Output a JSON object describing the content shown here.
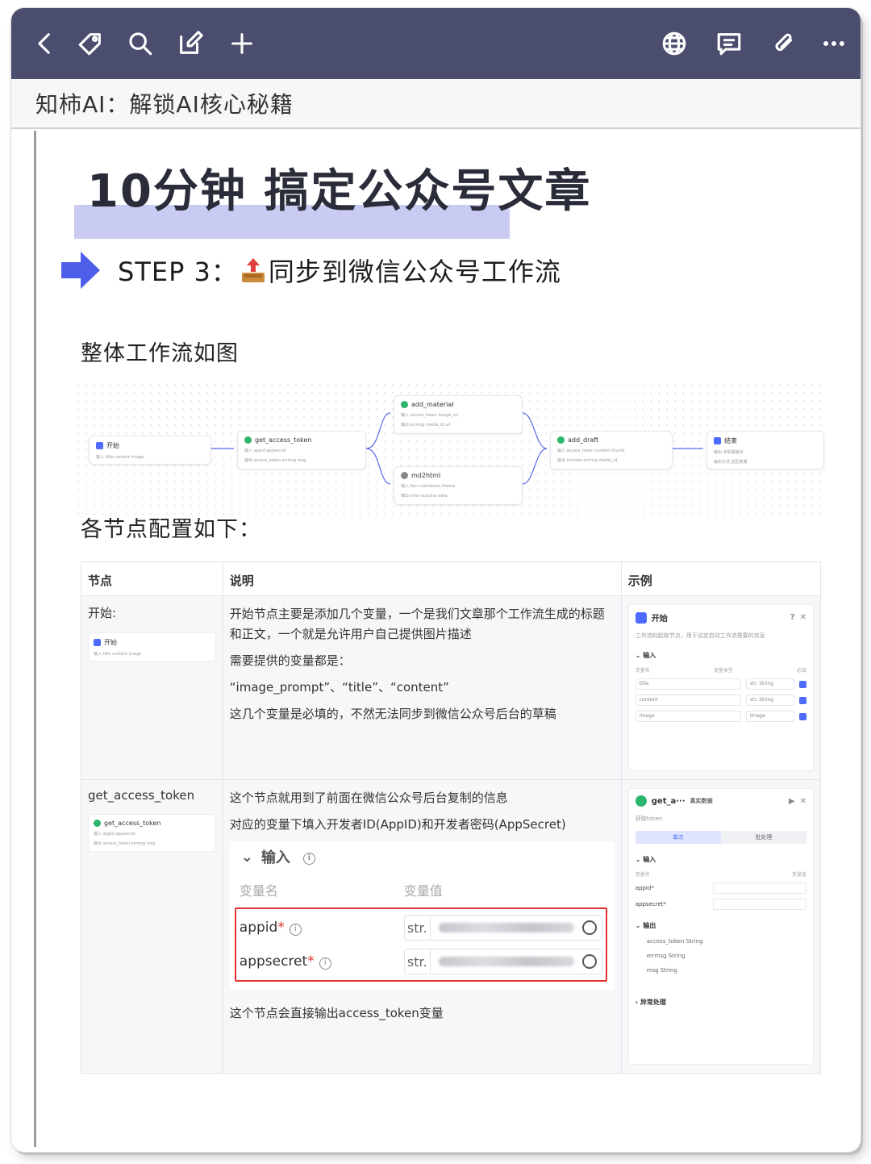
{
  "toolbar": {
    "icons": [
      "back-icon",
      "tag-icon",
      "search-icon",
      "edit-icon",
      "plus-icon",
      "globe-icon",
      "comment-icon",
      "attachment-icon",
      "more-icon"
    ]
  },
  "note": {
    "title": "知柿AI：解锁AI核心秘籍"
  },
  "doc": {
    "title": "10分钟 搞定公众号文章",
    "step_prefix": "STEP 3：",
    "step_text": "同步到微信公众号工作流",
    "flow_heading": "整体工作流如图",
    "nodes_heading": "各节点配置如下："
  },
  "flow": {
    "start": {
      "name": "开始",
      "row": "输入 title  content  image"
    },
    "get_token": {
      "name": "get_access_token",
      "row1": "输入 appid  appsecret",
      "row2": "输出 access_token  errmsg  msg"
    },
    "add_material": {
      "name": "add_material",
      "row1": "输入 access_token  image_url",
      "row2": "输出 errmsg  media_id  url"
    },
    "md2html": {
      "name": "md2html",
      "row1": "输入 font  markdown  theme",
      "row2": "输出 error  success  data"
    },
    "add_draft": {
      "name": "add_draft",
      "row1": "输入 access_token  content  thumb",
      "row2": "输出 errcode  errmsg  media_id"
    },
    "end": {
      "name": "结束",
      "row1": "输出 未配置输出",
      "row2": "输出方式 返回变量"
    }
  },
  "table": {
    "headers": [
      "节点",
      "说明",
      "示例"
    ],
    "row1": {
      "node": "开始:",
      "mini_name": "开始",
      "mini_row": "输入 title  content  image",
      "desc": [
        "开始节点主要是添加几个变量，一个是我们文章那个工作流生成的标题和正文，一个就是允许用户自己提供图片描述",
        "需要提供的变量都是：",
        "“image_prompt”、“title”、“content”",
        "这几个变量是必填的，不然无法同步到微信公众号后台的草稿"
      ],
      "panel": {
        "title": "开始",
        "sub": "工作流的起始节点，用于设定启动工作流需要的信息",
        "section": "输入",
        "labels": [
          "变量名",
          "变量类型",
          "必填"
        ],
        "vars": [
          {
            "name": "title",
            "type": "str. String"
          },
          {
            "name": "content",
            "type": "str. String"
          },
          {
            "name": "image",
            "type": "Image"
          }
        ]
      }
    },
    "row2": {
      "node": "get_access_token",
      "mini_name": "get_access_token",
      "mini_row1": "输入 appid  appsecret",
      "mini_row2": "输出 access_token  errmsg  msg",
      "desc1": "这个节点就用到了前面在微信公众号后台复制的信息",
      "desc2": "对应的变量下填入开发者ID(AppID)和开发者密码(AppSecret)",
      "input_label": "输入",
      "col_name": "变量名",
      "col_value": "变量值",
      "vars": [
        {
          "name": "appid",
          "type": "str."
        },
        {
          "name": "appsecret",
          "type": "str."
        }
      ],
      "after": "这个节点会直接输出access_token变量",
      "panel": {
        "title": "get_a···",
        "badge": "真实数据",
        "sub": "获取token",
        "tab1": "单次",
        "tab2": "批处理",
        "in_section": "输入",
        "in_labels": [
          "变量名",
          "变量值"
        ],
        "in_vars": [
          "appid*",
          "appsecret*"
        ],
        "out_section": "输出",
        "outs": [
          "access_token  String",
          "errmsg  String",
          "msg  String"
        ],
        "error_section": "异常处理"
      }
    }
  },
  "colors": {
    "toolbar": "#4a4d6e",
    "highlight": "#c9cbf2",
    "arrow": "#4d5ee8",
    "redbox": "#e0312e"
  }
}
